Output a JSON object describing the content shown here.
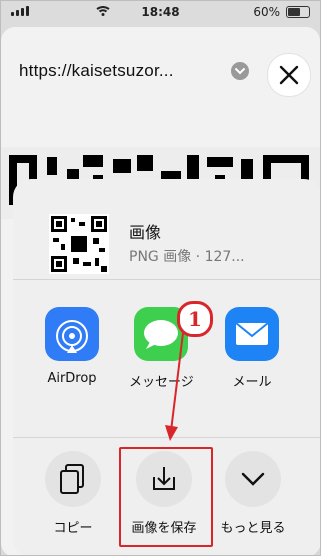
{
  "status": {
    "time": "18:48",
    "battery_text": "60%",
    "battery_level": 0.6
  },
  "browser": {
    "url_text": "https://kaisetsuzor...",
    "icons": {
      "chevron": "chevron-down-icon",
      "close": "close-icon"
    }
  },
  "share": {
    "title": "画像",
    "subtitle": "PNG 画像 · 127...",
    "apps": [
      {
        "label": "AirDrop",
        "icon": "airdrop-icon",
        "color": "#2f7cf6"
      },
      {
        "label": "メッセージ",
        "icon": "messages-icon",
        "color": "#3ecf4f"
      },
      {
        "label": "メール",
        "icon": "mail-icon",
        "color": "#1e84f6"
      }
    ],
    "actions": [
      {
        "label": "コピー",
        "icon": "copy-icon"
      },
      {
        "label": "画像を保存",
        "icon": "save-image-icon"
      },
      {
        "label": "もっと見る",
        "icon": "more-chevron-icon"
      }
    ]
  },
  "annotation": {
    "step_number": "1",
    "highlight_color": "#d9262a"
  }
}
